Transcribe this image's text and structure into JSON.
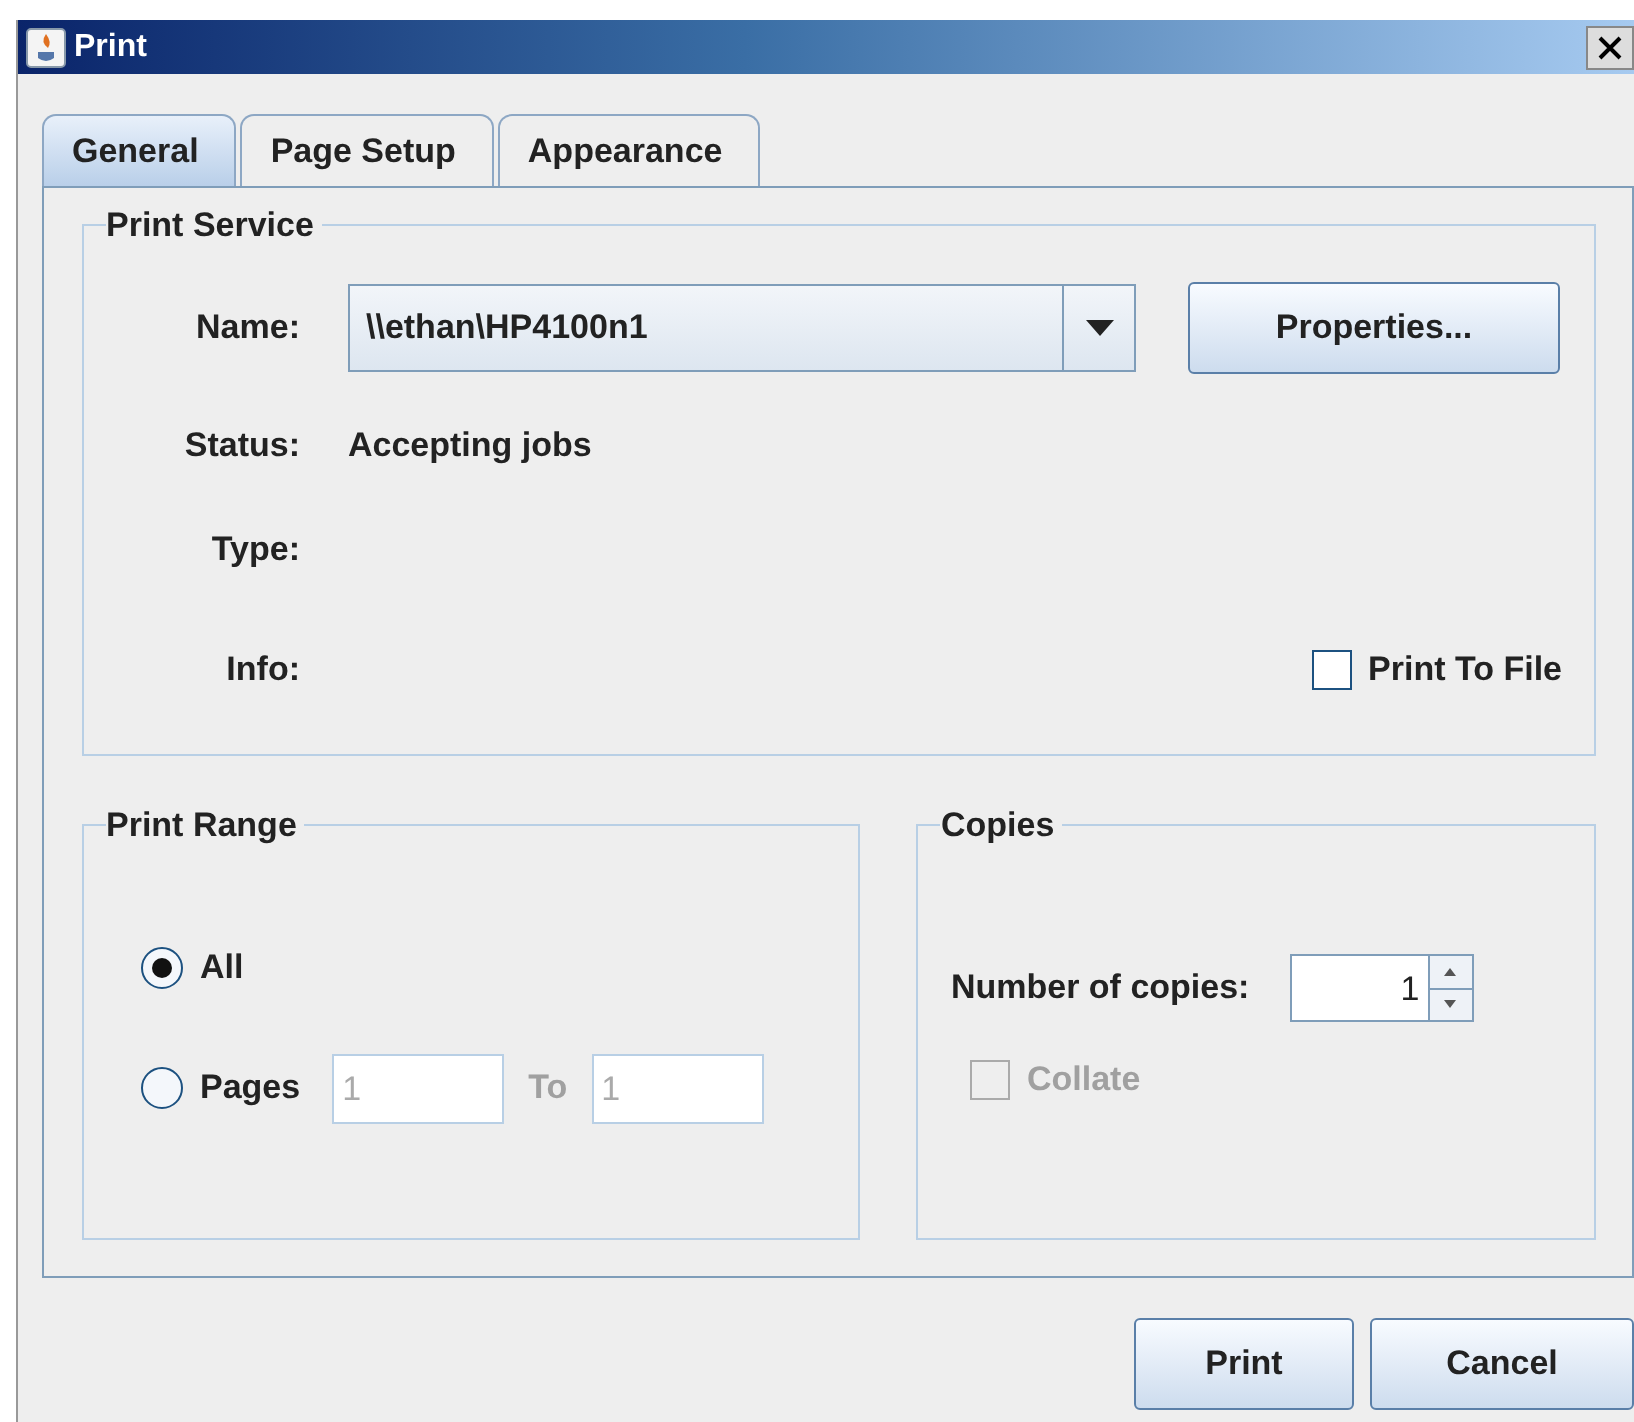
{
  "window": {
    "title": "Print"
  },
  "tabs": [
    {
      "label": "General",
      "selected": true
    },
    {
      "label": "Page Setup",
      "selected": false
    },
    {
      "label": "Appearance",
      "selected": false
    }
  ],
  "print_service": {
    "title": "Print Service",
    "name_label": {
      "text": "Name:"
    },
    "name_value": "\\\\ethan\\HP4100n1",
    "properties_button": {
      "label": "Properties..."
    },
    "fields": [
      {
        "label": "Status:",
        "value": "Accepting jobs"
      },
      {
        "label": "Type:"
      },
      {
        "label": "Info:"
      }
    ],
    "print_to_file": {
      "label": "Print To File",
      "checked": false
    }
  },
  "print_range": {
    "title": "Print Range",
    "options": [
      {
        "kind": "plain",
        "label": "All",
        "selected": true
      },
      {
        "kind": "range",
        "label": "Pages",
        "selected": false,
        "from": "1",
        "to_label": "To",
        "to": "1",
        "disabled": true
      }
    ]
  },
  "copies": {
    "title": "Copies",
    "label": "Number of copies:",
    "value": "1",
    "collate": {
      "label": "Collate",
      "checked": false,
      "disabled": true
    }
  },
  "buttons": [
    {
      "label": "Print"
    },
    {
      "label": "Cancel"
    }
  ]
}
